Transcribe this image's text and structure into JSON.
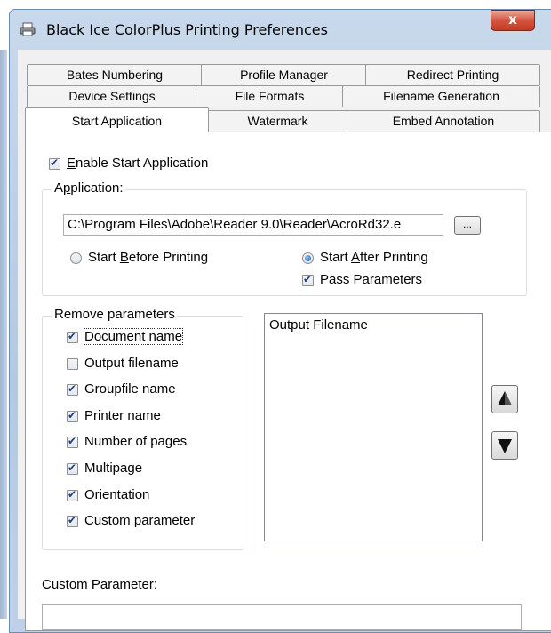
{
  "window": {
    "title": "Black Ice ColorPlus Printing Preferences",
    "close_label": "x"
  },
  "tabs": {
    "row1": [
      "Bates Numbering",
      "Profile Manager",
      "Redirect Printing"
    ],
    "row2": [
      "Device Settings",
      "File Formats",
      "Filename Generation"
    ],
    "row3": [
      "Start Application",
      "Watermark",
      "Embed Annotation"
    ],
    "active": "Start Application"
  },
  "start_app": {
    "enable_label_u": "E",
    "enable_label_rest": "nable Start Application",
    "enable_checked": true,
    "application_group_title_pre": "A",
    "application_group_title_u": "p",
    "application_group_title_post": "plication:",
    "path_value": "C:\\Program Files\\Adobe\\Reader 9.0\\Reader\\AcroRd32.e",
    "browse_label": "...",
    "before_label_pre": "Start ",
    "before_label_u": "B",
    "before_label_post": "efore Printing",
    "before_selected": false,
    "after_label_pre": "Start ",
    "after_label_u": "A",
    "after_label_post": "fter Printing",
    "after_selected": true,
    "pass_params_label": "Pass Parameters",
    "pass_params_checked": true
  },
  "remove_params": {
    "title": "Remove parameters",
    "items": [
      {
        "label": "Document name",
        "checked": true
      },
      {
        "label": "Output filename",
        "checked": false
      },
      {
        "label": "Groupfile name",
        "checked": true
      },
      {
        "label": "Printer name",
        "checked": true
      },
      {
        "label": "Number of pages",
        "checked": true
      },
      {
        "label": "Multipage",
        "checked": true
      },
      {
        "label": "Orientation",
        "checked": true
      },
      {
        "label": "Custom parameter",
        "checked": true
      }
    ]
  },
  "params_list": {
    "items": [
      "Output Filename"
    ]
  },
  "custom_parameter": {
    "label": "Custom Parameter:",
    "value": ""
  },
  "colors": {
    "accent": "#1b5fa8",
    "close_red": "#c43a22",
    "titlebar": "#b4c8e1"
  },
  "icons": {
    "title": "printer-icon",
    "move_up": "arrow-up-icon",
    "move_down": "arrow-down-icon"
  }
}
